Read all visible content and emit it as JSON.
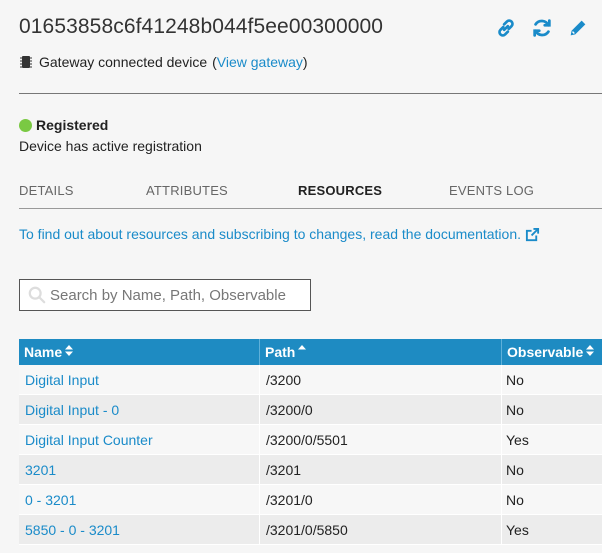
{
  "device": {
    "id": "01653858c6f41248b044f5ee00300000",
    "gateway_text": "Gateway connected device",
    "gateway_link": "View gateway"
  },
  "actions": [
    "link-icon",
    "refresh-icon",
    "edit-icon"
  ],
  "status": {
    "label": "Registered",
    "description": "Device has active registration",
    "color": "#7ac943"
  },
  "tabs": [
    {
      "label": "DETAILS",
      "active": false
    },
    {
      "label": "ATTRIBUTES",
      "active": false
    },
    {
      "label": "RESOURCES",
      "active": true
    },
    {
      "label": "EVENTS LOG",
      "active": false
    }
  ],
  "doc_link": "To find out about resources and subscribing to changes, read the documentation.",
  "search": {
    "placeholder": "Search by Name, Path, Observable",
    "value": ""
  },
  "table": {
    "headers": [
      "Name",
      "Path",
      "Observable"
    ],
    "sort": [
      "both",
      "asc",
      "both"
    ],
    "rows": [
      {
        "name": "Digital Input",
        "path": "/3200",
        "observable": "No"
      },
      {
        "name": "Digital Input - 0",
        "path": "/3200/0",
        "observable": "No"
      },
      {
        "name": "Digital Input Counter",
        "path": "/3200/0/5501",
        "observable": "Yes"
      },
      {
        "name": "3201",
        "path": "/3201",
        "observable": "No"
      },
      {
        "name": "0 - 3201",
        "path": "/3201/0",
        "observable": "No"
      },
      {
        "name": "5850 - 0 - 3201",
        "path": "/3201/0/5850",
        "observable": "Yes"
      }
    ]
  },
  "colors": {
    "accent": "#1a8bc9",
    "header_bg": "#1e8bc2"
  }
}
